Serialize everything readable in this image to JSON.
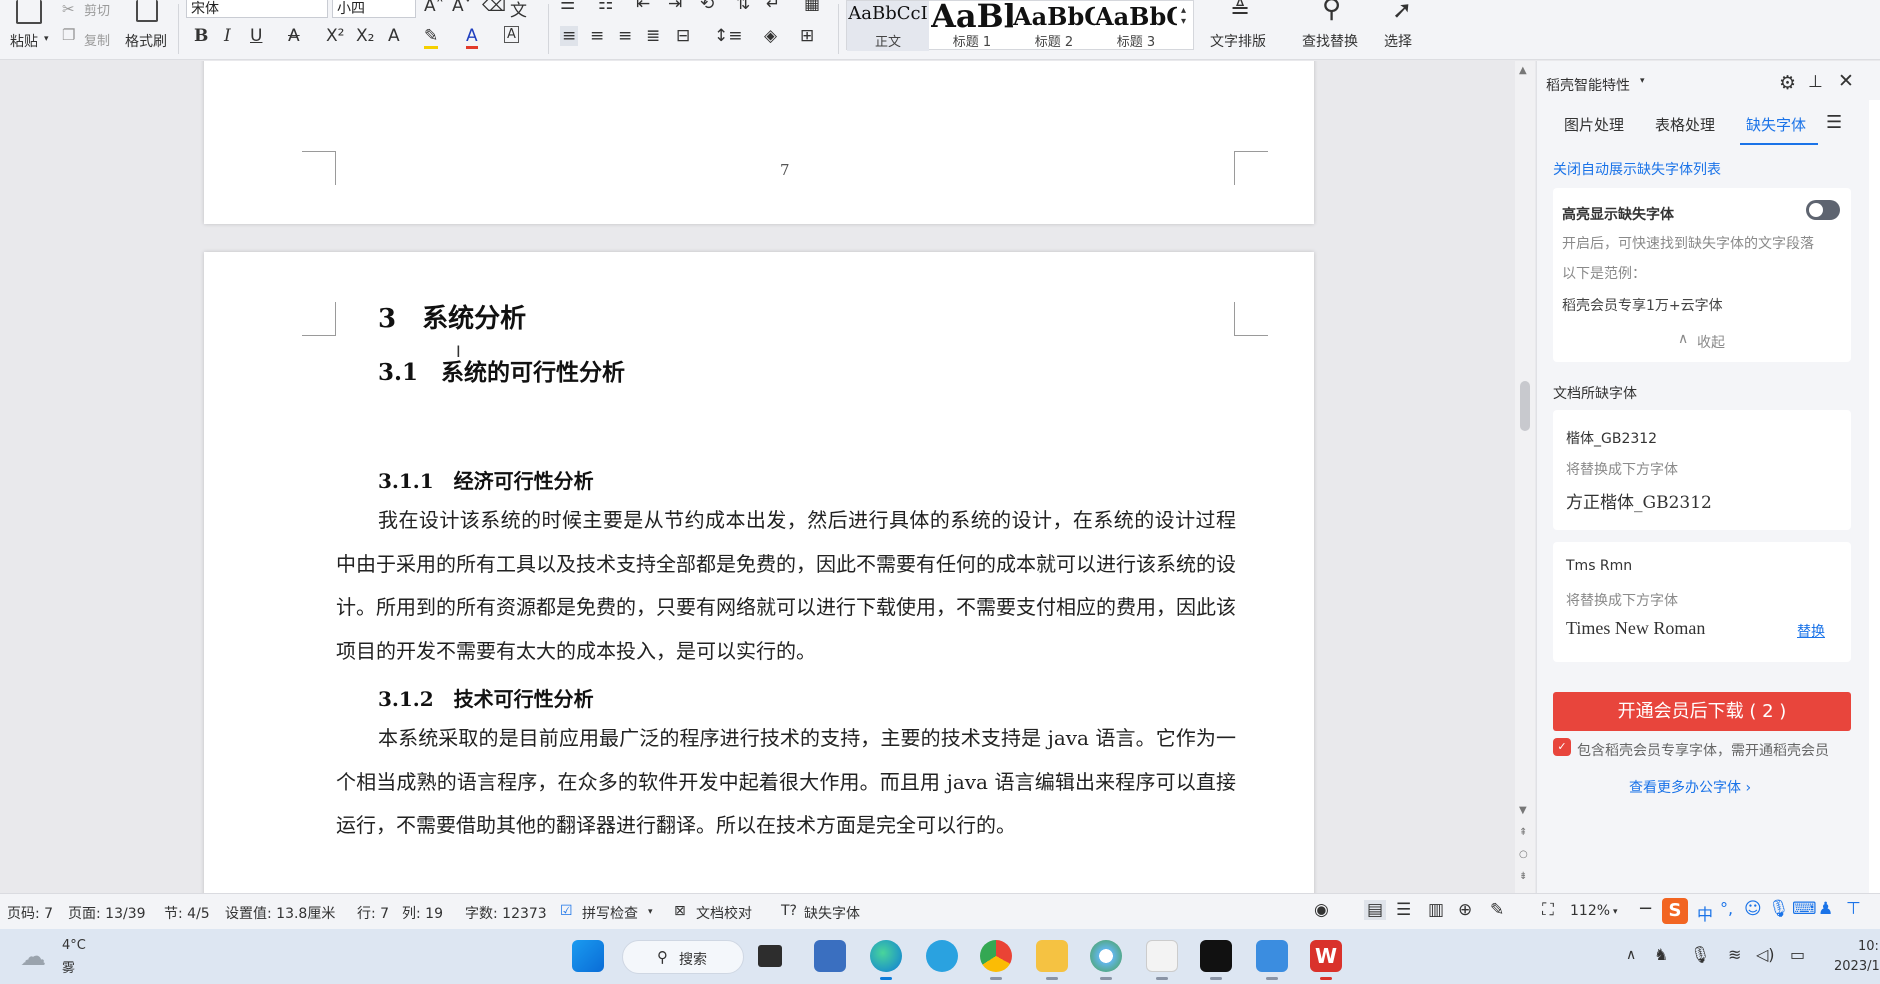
{
  "ribbon": {
    "paste": "粘贴",
    "cut": "剪切",
    "copy": "复制",
    "format_painter": "格式刷",
    "font_name": "宋体",
    "font_size": "小四",
    "styles": [
      {
        "preview": "AaBbCcI",
        "name": "正文"
      },
      {
        "preview": "AaBl",
        "name": "标题 1"
      },
      {
        "preview": "AaBbC",
        "name": "标题 2"
      },
      {
        "preview": "AaBbC",
        "name": "标题 3"
      }
    ],
    "text_layout": "文字排版",
    "find_replace": "查找替换",
    "select": "选择"
  },
  "document": {
    "prev_page_number": "7",
    "heading1": "3　系统分析",
    "heading2": "3.1　系统的可行性分析",
    "heading3a": "3.1.1　经济可行性分析",
    "para1": "我在设计该系统的时候主要是从节约成本出发，然后进行具体的系统的设计，在系统的设计过程中由于采用的所有工具以及技术支持全部都是免费的，因此不需要有任何的成本就可以进行该系统的设计。所用到的所有资源都是免费的，只要有网络就可以进行下载使用，不需要支付相应的费用，因此该项目的开发不需要有太大的成本投入，是可以实行的。",
    "heading3b": "3.1.2　技术可行性分析",
    "para2": "本系统采取的是目前应用最广泛的程序进行技术的支持，主要的技术支持是 java 语言。它作为一个相当成熟的语言程序，在众多的软件开发中起着很大作用。而且用 java 语言编辑出来程序可以直接运行，不需要借助其他的翻译器进行翻译。所以在技术方面是完全可以行的。"
  },
  "panel": {
    "title": "稻壳智能特性",
    "tabs": [
      "图片处理",
      "表格处理",
      "缺失字体"
    ],
    "close_auto_link": "关闭自动展示缺失字体列表",
    "highlight_title": "高亮显示缺失字体",
    "highlight_desc": "开启后，可快速找到缺失字体的文字段落",
    "example_label": "以下是范例：",
    "example_text": "稻壳会员专享1万+云字体",
    "collapse": "收起",
    "missing_section": "文档所缺字体",
    "fonts": [
      {
        "missing": "楷体_GB2312",
        "hint": "将替换成下方字体",
        "replacement": "方正楷体_GB2312",
        "action": ""
      },
      {
        "missing": "Tms Rmn",
        "hint": "将替换成下方字体",
        "replacement": "Times New Roman",
        "action": "替换"
      }
    ],
    "cta": "开通会员后下载 ( 2 )",
    "notice": "包含稻壳会员专享字体，需开通稻壳会员",
    "more_link": "查看更多办公字体 ›"
  },
  "status": {
    "page_code": "页码: 7",
    "page": "页面: 13/39",
    "section": "节: 4/5",
    "setting": "设置值: 13.8厘米",
    "row": "行: 7",
    "col": "列: 19",
    "wordcount": "字数: 12373",
    "spellcheck": "拼写检查",
    "proofread": "文档校对",
    "missing_font": "缺失字体",
    "zoom": "112%"
  },
  "taskbar": {
    "weather_temp": "4°C",
    "weather_desc": "雾",
    "search": "搜索",
    "time": "10:",
    "date": "2023/1",
    "ime": "中"
  },
  "colors": {
    "accent": "#1a73e8",
    "cta": "#e8453c",
    "wps_red": "#d9322b"
  }
}
